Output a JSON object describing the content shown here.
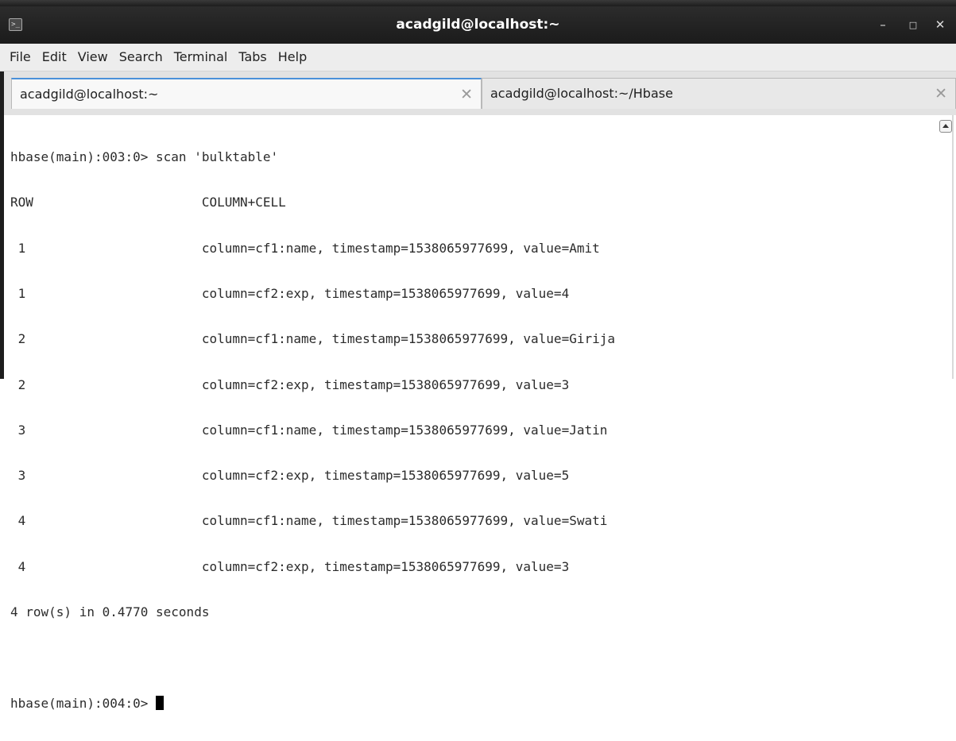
{
  "window": {
    "title": "acadgild@localhost:~"
  },
  "menu": {
    "items": [
      "File",
      "Edit",
      "View",
      "Search",
      "Terminal",
      "Tabs",
      "Help"
    ]
  },
  "tabs": [
    {
      "label": "acadgild@localhost:~",
      "active": true,
      "close_icon": "close-icon"
    },
    {
      "label": "acadgild@localhost:~/Hbase",
      "active": false,
      "close_icon": "close-icon"
    }
  ],
  "terminal": {
    "lines": [
      "hbase(main):003:0> scan 'bulktable'",
      "ROW                      COLUMN+CELL",
      " 1                       column=cf1:name, timestamp=1538065977699, value=Amit",
      " 1                       column=cf2:exp, timestamp=1538065977699, value=4",
      " 2                       column=cf1:name, timestamp=1538065977699, value=Girija",
      " 2                       column=cf2:exp, timestamp=1538065977699, value=3",
      " 3                       column=cf1:name, timestamp=1538065977699, value=Jatin",
      " 3                       column=cf2:exp, timestamp=1538065977699, value=5",
      " 4                       column=cf1:name, timestamp=1538065977699, value=Swati",
      " 4                       column=cf2:exp, timestamp=1538065977699, value=3",
      "4 row(s) in 0.4770 seconds",
      ""
    ],
    "prompt": "hbase(main):004:0> "
  },
  "colors": {
    "titlebar": "#1b1b1b",
    "active_tab_accent": "#4a90d9",
    "terminal_bg": "#ffffff",
    "terminal_text": "#2b2b2b"
  }
}
